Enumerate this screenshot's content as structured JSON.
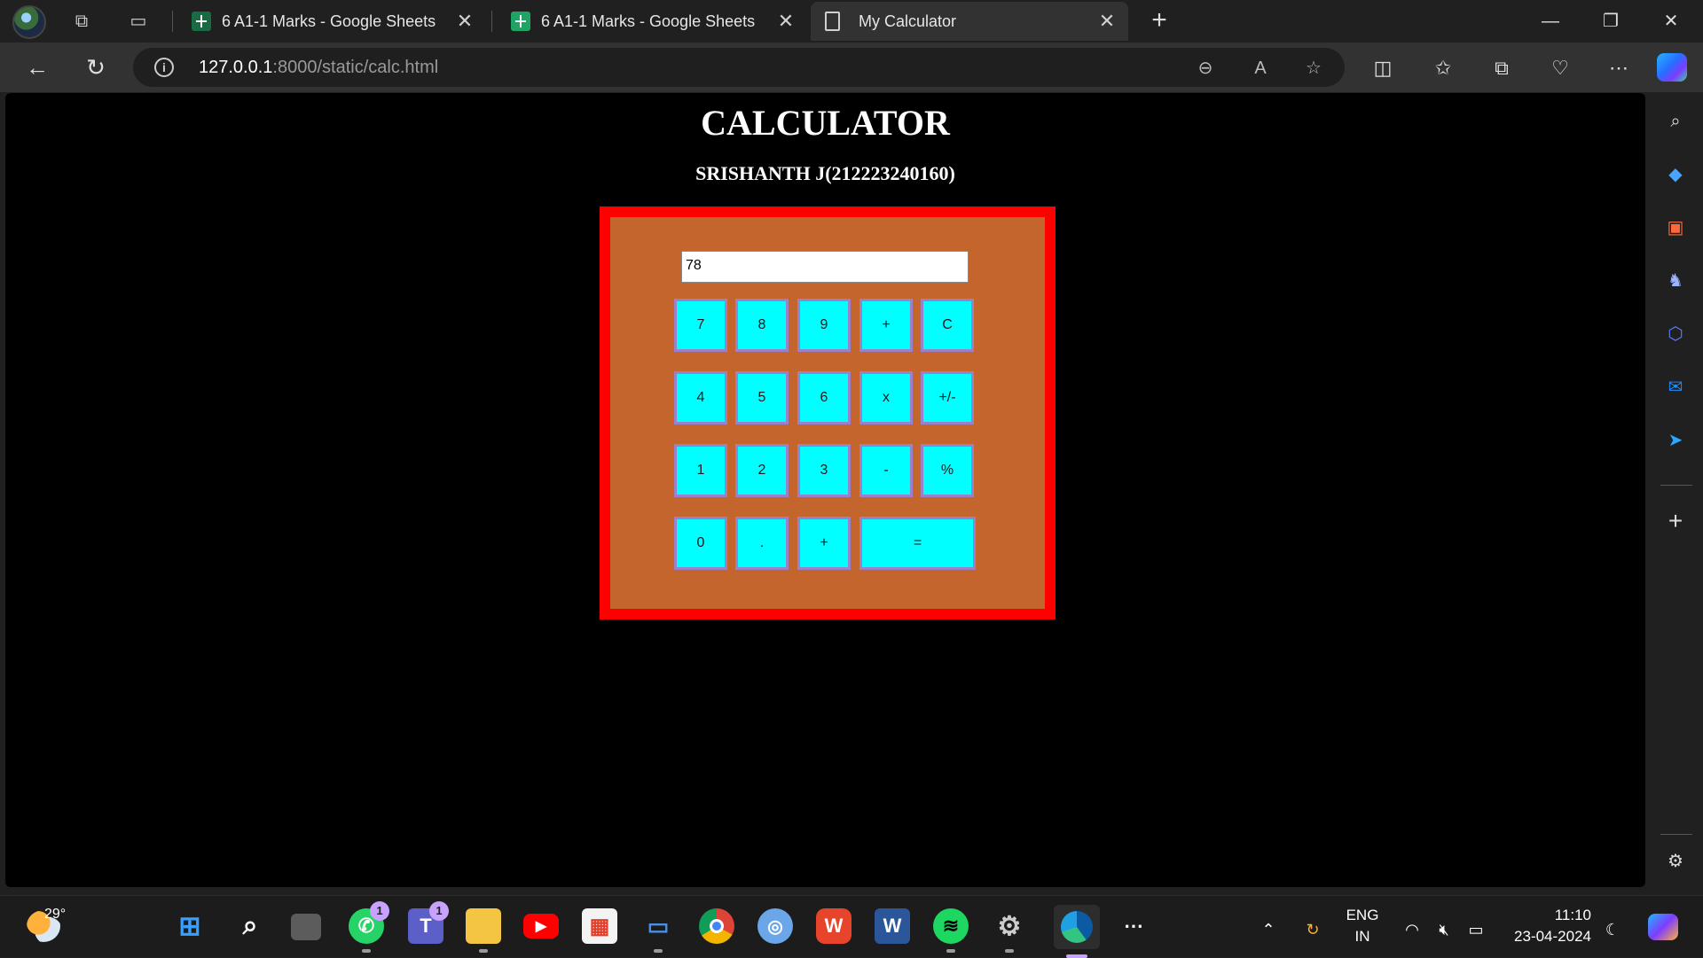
{
  "browser": {
    "tabs": [
      {
        "title": "6 A1-1 Marks - Google Sheets",
        "close": "✕"
      },
      {
        "title": "6 A1-1 Marks - Google Sheets",
        "close": "✕"
      },
      {
        "title": "My Calculator",
        "close": "✕"
      }
    ],
    "new_tab": "+",
    "window_controls": {
      "minimize": "—",
      "restore": "❐",
      "close": "✕"
    },
    "url_host": "127.0.0.1",
    "url_rest": ":8000/static/calc.html",
    "info_icon": "i"
  },
  "page": {
    "title": "CALCULATOR",
    "subtitle": "SRISHANTH J(212223240160)",
    "display_value": "78",
    "rows": [
      [
        "7",
        "8",
        "9",
        "+",
        "C"
      ],
      [
        "4",
        "5",
        "6",
        "x",
        "+/-"
      ],
      [
        "1",
        "2",
        "3",
        "-",
        "%"
      ],
      [
        "0",
        ".",
        "+",
        "="
      ]
    ],
    "colors": {
      "frame": "#ff0000",
      "body": "#c5652e",
      "key": "#00ffff",
      "key_border": "#9b82c8",
      "background": "#000000"
    }
  },
  "taskbar": {
    "temperature": "29°",
    "whatsapp_badge": "1",
    "teams_badge": "1",
    "language_top": "ENG",
    "language_bottom": "IN",
    "time": "11:10",
    "date": "23-04-2024"
  }
}
